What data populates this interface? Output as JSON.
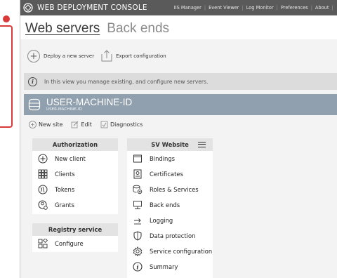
{
  "window": {
    "title": "WEB DEPLOYMENT CONSOLE",
    "menu": [
      "IIS Manager",
      "Event Viewer",
      "Log Monitor",
      "Preferences",
      "About"
    ],
    "controls": [
      "–",
      "▢"
    ]
  },
  "tabs": [
    {
      "label": "Web servers",
      "active": true
    },
    {
      "label": "Back ends",
      "active": false
    }
  ],
  "toolbar": {
    "deploy_label": "Deploy a new server",
    "export_label": "Export configuration"
  },
  "info": {
    "text": "In this view you manage existing, and configure new servers."
  },
  "machine": {
    "name": "USER-MACHINE-ID",
    "subtitle": "USER-MACHINE-ID"
  },
  "actions": {
    "new_site": "New site",
    "edit": "Edit",
    "diagnostics": "Diagnostics"
  },
  "authorization": {
    "title": "Authorization",
    "items": [
      {
        "label": "New client",
        "icon": "plus-circle-icon"
      },
      {
        "label": "Clients",
        "icon": "clients-grid-icon"
      },
      {
        "label": "Tokens",
        "icon": "token-icon"
      },
      {
        "label": "Grants",
        "icon": "grants-icon"
      }
    ]
  },
  "registry": {
    "title": "Registry service",
    "items": [
      {
        "label": "Configure",
        "icon": "configure-icon"
      }
    ]
  },
  "website": {
    "title": "SV Website",
    "items": [
      {
        "label": "Bindings",
        "icon": "bindings-icon"
      },
      {
        "label": "Certificates",
        "icon": "certificate-icon"
      },
      {
        "label": "Roles & Services",
        "icon": "roles-icon"
      },
      {
        "label": "Back ends",
        "icon": "backend-icon"
      },
      {
        "label": "Logging",
        "icon": "logging-icon"
      },
      {
        "label": "Data protection",
        "icon": "shield-icon"
      },
      {
        "label": "Service configuration",
        "icon": "gear-icon"
      },
      {
        "label": "Summary",
        "icon": "info-icon"
      }
    ]
  },
  "colors": {
    "titlebar": "#5a5a5a",
    "machine_bar": "#90a0ae",
    "highlight_bracket": "#d83a3a"
  }
}
